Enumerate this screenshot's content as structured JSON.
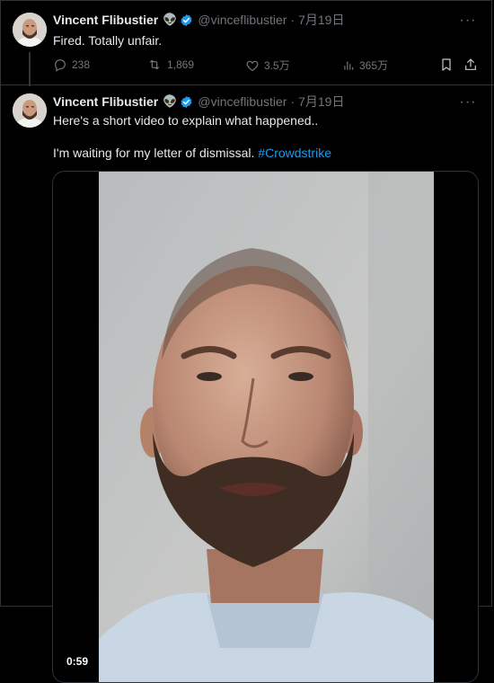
{
  "tweets": [
    {
      "author": {
        "name": "Vincent Flibustier",
        "badge_emoji": "👽",
        "verified": true,
        "handle": "@vinceflibustier",
        "date": "7月19日"
      },
      "text": "Fired. Totally unfair.",
      "more_label": "···",
      "metrics": {
        "replies": "238",
        "retweets": "1,869",
        "likes": "3.5万",
        "views": "365万"
      },
      "icons": [
        "reply-icon",
        "retweet-icon",
        "like-icon",
        "views-icon",
        "bookmark-icon",
        "share-icon"
      ]
    },
    {
      "author": {
        "name": "Vincent Flibustier",
        "badge_emoji": "👽",
        "verified": true,
        "handle": "@vinceflibustier",
        "date": "7月19日"
      },
      "text_line1": "Here's a short video to explain what happened..",
      "text_line2_prefix": "I'm waiting for my letter of dismissal. ",
      "hashtag": "#Crowdstrike",
      "more_label": "···",
      "video": {
        "duration": "0:59"
      }
    }
  ],
  "colors": {
    "background": "#000000",
    "text": "#e7e9ea",
    "muted": "#71767b",
    "accent": "#1d9bf0",
    "border": "#2f3336"
  }
}
